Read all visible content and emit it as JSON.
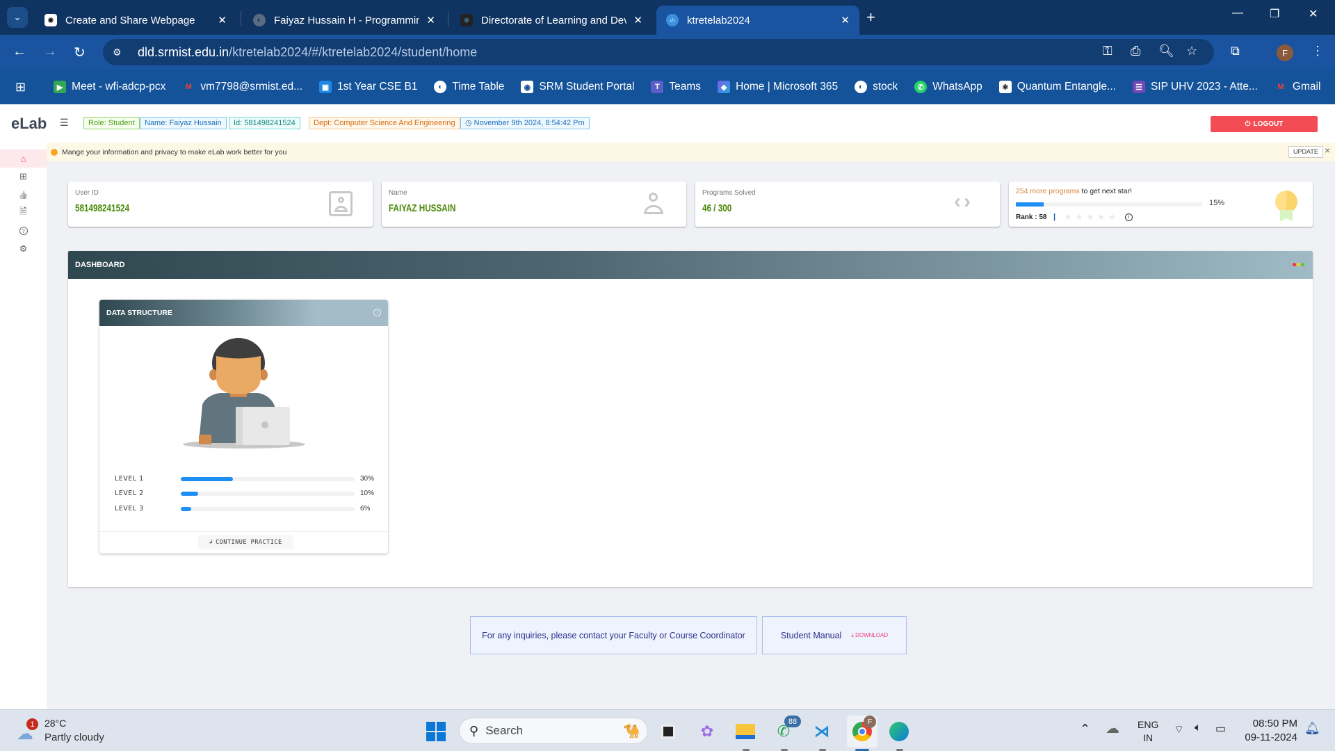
{
  "browser": {
    "tabs": [
      {
        "title": "Create and Share Webpage",
        "icon": "chatgpt-icon",
        "active": false
      },
      {
        "title": "Faiyaz Hussain H - Programming",
        "icon": "globe-icon",
        "active": false
      },
      {
        "title": "Directorate of Learning and Dev",
        "icon": "react-icon",
        "active": false
      },
      {
        "title": "ktretelab2024",
        "icon": "elab-icon",
        "active": true
      }
    ],
    "url_host": "dld.srmist.edu.in",
    "url_path": "/ktretelab2024/#/ktretelab2024/student/home",
    "profile_initial": "F",
    "bookmarks": [
      {
        "label": "Meet - wfi-adcp-pcx",
        "icon": "google-meet-icon"
      },
      {
        "label": "vm7798@srmist.ed...",
        "icon": "gmail-icon"
      },
      {
        "label": "1st Year CSE B1",
        "icon": "classroom-icon"
      },
      {
        "label": "Time Table",
        "icon": "globe-icon"
      },
      {
        "label": "SRM Student Portal",
        "icon": "srm-icon"
      },
      {
        "label": "Teams",
        "icon": "teams-icon"
      },
      {
        "label": "Home | Microsoft 365",
        "icon": "m365-icon"
      },
      {
        "label": "stock",
        "icon": "globe-icon"
      },
      {
        "label": "WhatsApp",
        "icon": "whatsapp-icon"
      },
      {
        "label": "Quantum Entangle...",
        "icon": "quantum-icon"
      },
      {
        "label": "SIP UHV 2023 - Atte...",
        "icon": "forms-icon"
      },
      {
        "label": "Gmail",
        "icon": "gmail-icon"
      }
    ],
    "more_bookmarks": "»"
  },
  "header": {
    "logo": "eLab",
    "badges": {
      "role": "Role: Student",
      "name": "Name: Faiyaz Hussain",
      "id": "Id: 581498241524",
      "dept": "Dept: Computer Science And Engineering",
      "datetime": "November 9th 2024, 8:54:42 Pm"
    },
    "logout": "LOGOUT"
  },
  "sidebar": {
    "items": [
      {
        "name": "home",
        "icon": "⌂",
        "active": true
      },
      {
        "name": "add",
        "icon": "⊞",
        "active": false
      },
      {
        "name": "like",
        "icon": "👍",
        "active": false
      },
      {
        "name": "document",
        "icon": "🗎",
        "active": false
      },
      {
        "name": "help",
        "icon": "?",
        "active": false
      },
      {
        "name": "settings",
        "icon": "⚙",
        "active": false
      }
    ]
  },
  "notice": {
    "text": "Mange your information and privacy to make eLab work better for you",
    "update": "UPDATE",
    "close": "×"
  },
  "stats": {
    "user_id_label": "User ID",
    "user_id": "581498241524",
    "name_label": "Name",
    "name": "FAIYAZ HUSSAIN",
    "programs_label": "Programs Solved",
    "programs": "46 / 300",
    "next_star_highlight": "254 more programs",
    "next_star_rest": " to get next star!",
    "star_progress": 15,
    "star_progress_label": "15%",
    "rank": "Rank : 58",
    "stars_filled": 0,
    "stars_total": 5
  },
  "dashboard": {
    "title": "DASHBOARD",
    "course": {
      "title": "DATA STRUCTURE",
      "levels": [
        {
          "label": "LEVEL 1",
          "percent": 30,
          "text": "30%"
        },
        {
          "label": "LEVEL 2",
          "percent": 10,
          "text": "10%"
        },
        {
          "label": "LEVEL 3",
          "percent": 6,
          "text": "6%"
        }
      ],
      "continue": "CONTINUE PRACTICE"
    }
  },
  "footer": {
    "inquiry": "For any inquiries, please contact your Faculty or Course Coordinator",
    "manual": "Student Manual",
    "download": "DOWNLOAD"
  },
  "taskbar": {
    "weather_temp": "28°C",
    "weather_desc": "Partly cloudy",
    "weather_badge": "1",
    "search": "Search",
    "whatsapp_badge": "88",
    "chrome_badge": "F",
    "lang": "ENG",
    "region": "IN",
    "time": "08:50 PM",
    "date": "09-11-2024"
  }
}
